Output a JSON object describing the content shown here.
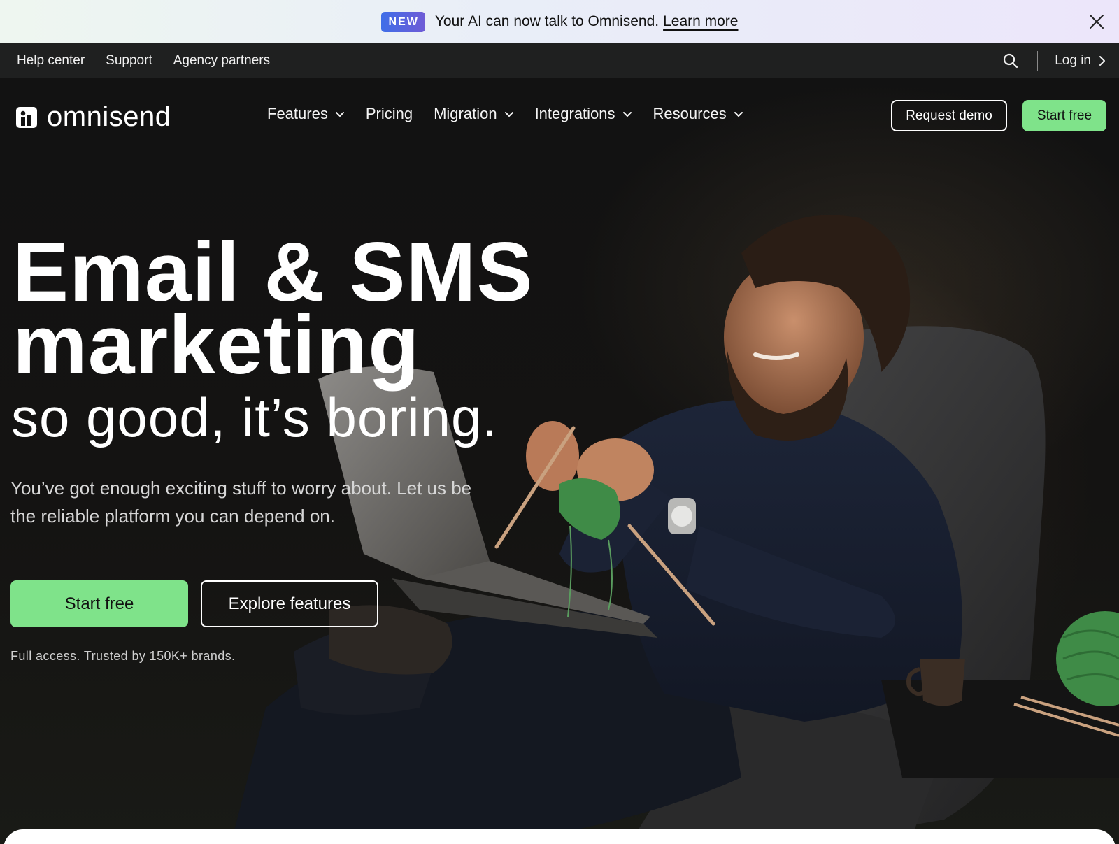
{
  "announcement": {
    "badge": "NEW",
    "text": "Your AI can now talk to Omnisend.",
    "link": "Learn more"
  },
  "utility": {
    "links": [
      "Help center",
      "Support",
      "Agency partners"
    ],
    "login": "Log in"
  },
  "nav": {
    "logo": "omnisend",
    "items": [
      "Features",
      "Pricing",
      "Migration",
      "Integrations",
      "Resources"
    ],
    "request_demo": "Request demo",
    "start_free": "Start free"
  },
  "hero": {
    "headline_line1": "Email & SMS",
    "headline_line2": "marketing",
    "subhead": "so good, it’s boring.",
    "description": "You’ve got enough exciting stuff to worry about. Let us be the reliable platform you can depend on.",
    "cta_primary": "Start free",
    "cta_secondary": "Explore features",
    "trusted": "Full access. Trusted by 150K+ brands."
  },
  "colors": {
    "accent_green": "#7fe38a",
    "utility_bar": "#1f2020",
    "badge_blue": "#4f67e0"
  },
  "icons": [
    "close-icon",
    "search-icon",
    "chevron-right-icon",
    "chevron-down-icon",
    "omnisend-logo-icon"
  ]
}
